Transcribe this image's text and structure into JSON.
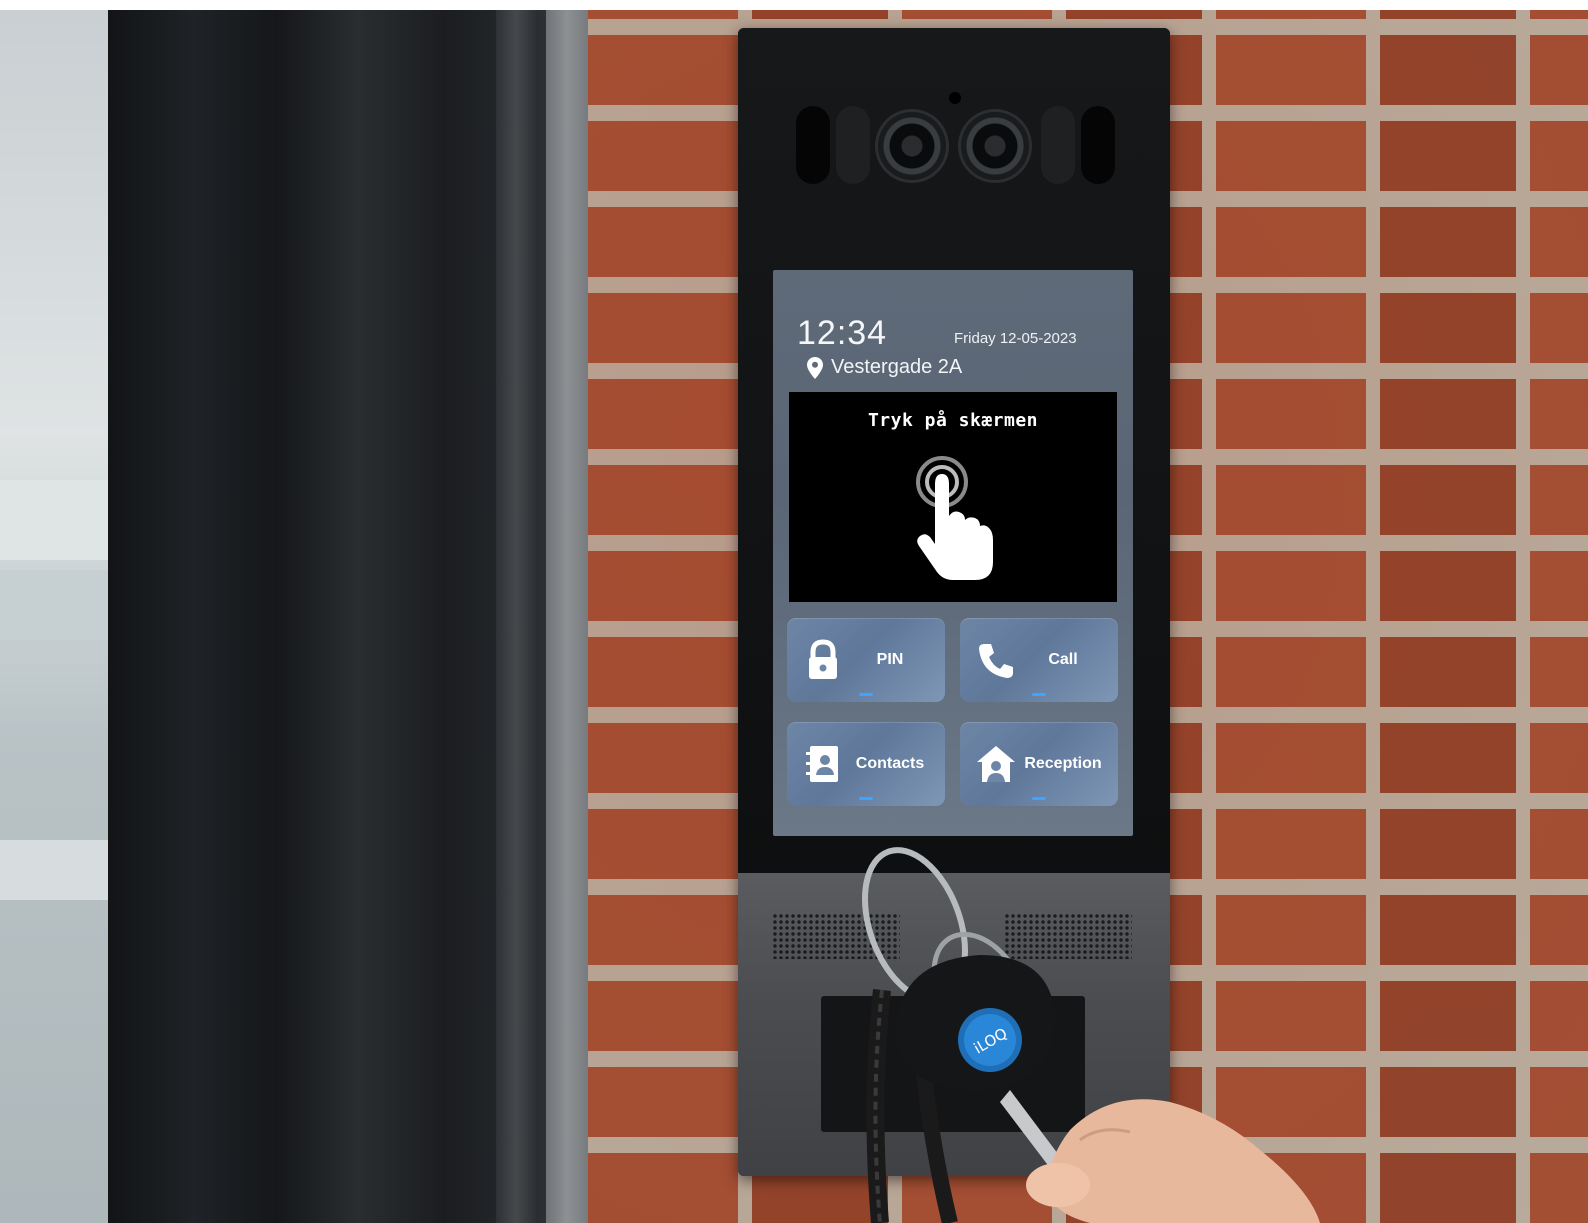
{
  "screen": {
    "time": "12:34",
    "date": "Friday 12-05-2023",
    "location": "Vestergade 2A",
    "touch_prompt": "Tryk på skærmen",
    "buttons": [
      {
        "label": "PIN",
        "icon": "lock-icon"
      },
      {
        "label": "Call",
        "icon": "phone-icon"
      },
      {
        "label": "Contacts",
        "icon": "contacts-icon"
      },
      {
        "label": "Reception",
        "icon": "reception-icon"
      }
    ],
    "accent_color": "#3da5ff",
    "tile_color": "#6e86a6"
  },
  "fob_label": "iLOQ"
}
